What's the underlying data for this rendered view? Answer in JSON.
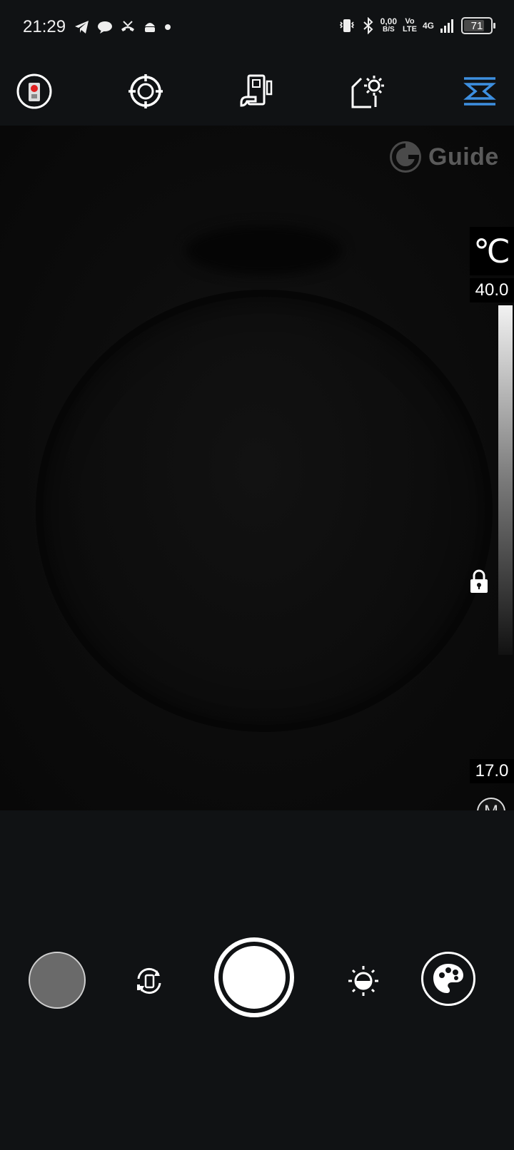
{
  "status_bar": {
    "time": "21:29",
    "net_speed_value": "0,00",
    "net_speed_unit": "B/S",
    "volte_top": "Vo",
    "volte_bottom": "LTE",
    "network_gen": "4G",
    "battery": "71"
  },
  "toolbar": {
    "items": [
      "camera-mode",
      "target",
      "device-settings",
      "image-settings",
      "spot-range"
    ],
    "active_color": "#3d8fe0"
  },
  "viewer": {
    "brand": "Guide"
  },
  "scale": {
    "unit": "℃",
    "max": "40.0",
    "min": "17.0",
    "mode": "M"
  },
  "colors": {
    "background": "#101214",
    "accent": "#3d8fe0"
  }
}
